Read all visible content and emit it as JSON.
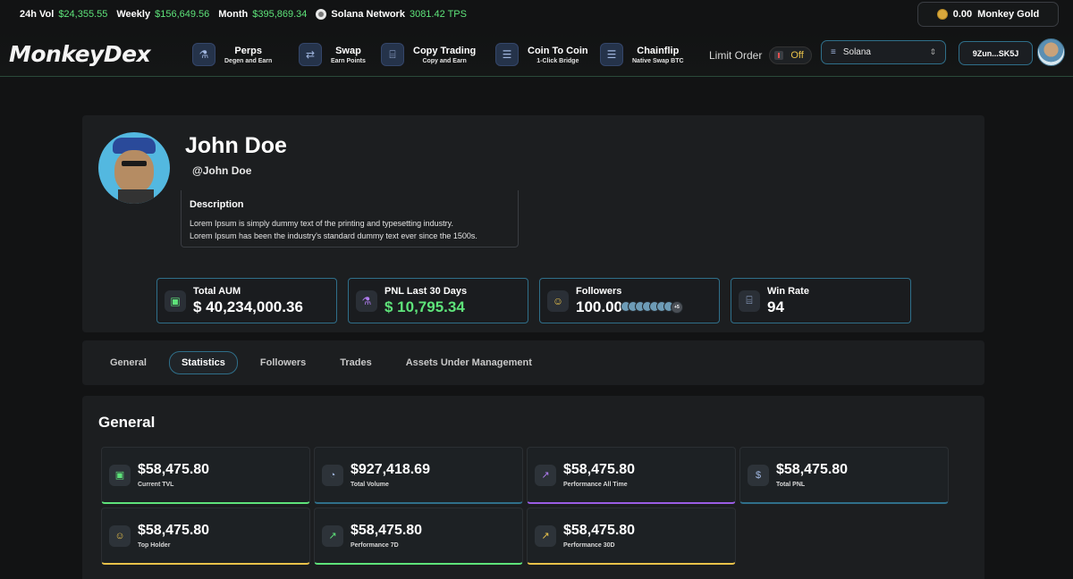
{
  "statbar": {
    "vol24h_label": "24h Vol",
    "vol24h": "$24,355.55",
    "weekly_label": "Weekly",
    "weekly": "$156,649.56",
    "month_label": "Month",
    "month": "$395,869.34",
    "network_label": "Solana Network",
    "tps": "3081.42 TPS"
  },
  "gold": {
    "amount": "0.00",
    "label": "Monkey Gold"
  },
  "logo": "MonkeyDex",
  "nav": [
    {
      "title": "Perps",
      "sub": "Degen and Earn",
      "icon": "flask-icon"
    },
    {
      "title": "Swap",
      "sub": "Earn Points",
      "icon": "swap-icon"
    },
    {
      "title": "Copy Trading",
      "sub": "Copy and Earn",
      "icon": "chart-board-icon"
    },
    {
      "title": "Coin To Coin",
      "sub": "1-Click Bridge",
      "icon": "database-icon"
    },
    {
      "title": "Chainflip",
      "sub": "Native Swap BTC",
      "icon": "database-icon"
    }
  ],
  "limit_order": {
    "label": "Limit Order",
    "state": "Off"
  },
  "network_select": {
    "value": "Solana"
  },
  "wallet": "9Zun...SK5J",
  "profile": {
    "name": "John Doe",
    "handle": "@John Doe",
    "description_title": "Description",
    "description_1": "Lorem Ipsum is simply dummy text of the printing and typesetting industry.",
    "description_2": "Lorem Ipsum has been the industry's standard dummy text ever since the 1500s.",
    "stats": [
      {
        "label": "Total AUM",
        "value": "$ 40,234,000.36",
        "icon": "money-icon"
      },
      {
        "label": "PNL Last 30 Days",
        "value": "$ 10,795.34",
        "icon": "flask-icon"
      },
      {
        "label": "Followers",
        "value": "100.00",
        "icon": "user-icon",
        "extra": "+5"
      },
      {
        "label": "Win Rate",
        "value": "94",
        "icon": "chart-board-icon"
      }
    ]
  },
  "tabs": [
    "General",
    "Statistics",
    "Followers",
    "Trades",
    "Assets Under Management"
  ],
  "active_tab": "Statistics",
  "general": {
    "title": "General",
    "cards": [
      {
        "value": "$58,475.80",
        "label": "Current TVL",
        "icon": "money-icon",
        "color": "#5ee37a"
      },
      {
        "value": "$927,418.69",
        "label": "Total Volume",
        "icon": "pie-icon",
        "color": "#2f6f8a"
      },
      {
        "value": "$58,475.80",
        "label": "Performance All Time",
        "icon": "trend-icon",
        "color": "#9b5de5"
      },
      {
        "value": "$58,475.80",
        "label": "Total PNL",
        "icon": "dollar-icon",
        "color": "#2f6f8a"
      },
      {
        "value": "$58,475.80",
        "label": "Top Holder",
        "icon": "user-icon",
        "color": "#e8c14a"
      },
      {
        "value": "$58,475.80",
        "label": "Performance 7D",
        "icon": "trend-icon",
        "color": "#5ee37a"
      },
      {
        "value": "$58,475.80",
        "label": "Performance 30D",
        "icon": "trend-icon",
        "color": "#e8c14a"
      }
    ]
  }
}
